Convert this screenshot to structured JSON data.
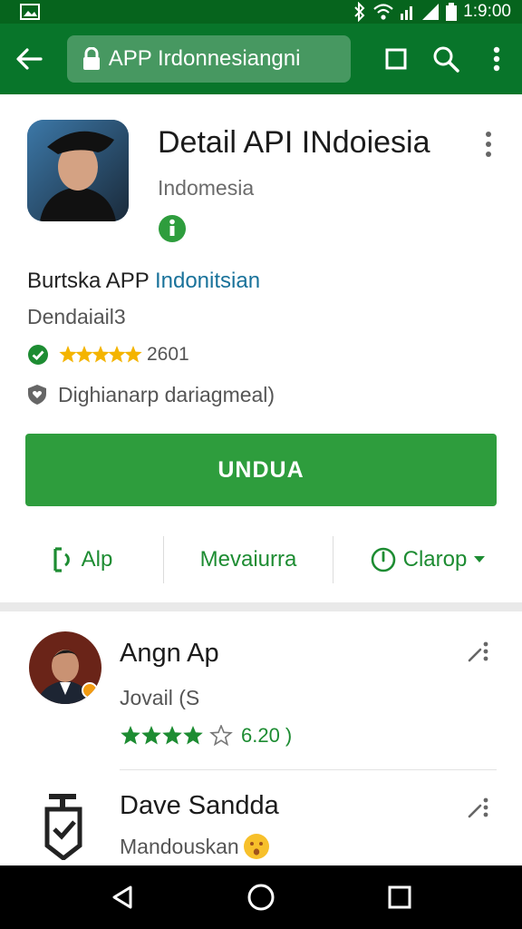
{
  "status_bar": {
    "time": "1:9:00"
  },
  "toolbar": {
    "url_text": "APP Irdonnesiangni"
  },
  "app": {
    "title": "Detail API INdoiesia",
    "subtitle": "Indomesia",
    "developer_prefix": "Burtska APP",
    "developer_link": "Indonitsian",
    "tag": "Dendaiail3",
    "rating_count": "2601",
    "note": "Dighianarp dariagmeal)",
    "install_label": "UNDUA"
  },
  "actions": {
    "app_label": "Alp",
    "middle_label": "Mevaiurra",
    "right_label": "Clarop"
  },
  "reviews": [
    {
      "name": "Angn Ap",
      "sub": "Jovail (S",
      "rating_text": "6.20 )"
    },
    {
      "name": "Dave Sandda",
      "sub": "Mandouskan"
    }
  ],
  "colors": {
    "appbar": "#08752a",
    "statusbar": "#06641d",
    "accent_green": "#2e9d3d",
    "link_blue": "#19729a",
    "star_yellow": "#f4b400"
  }
}
